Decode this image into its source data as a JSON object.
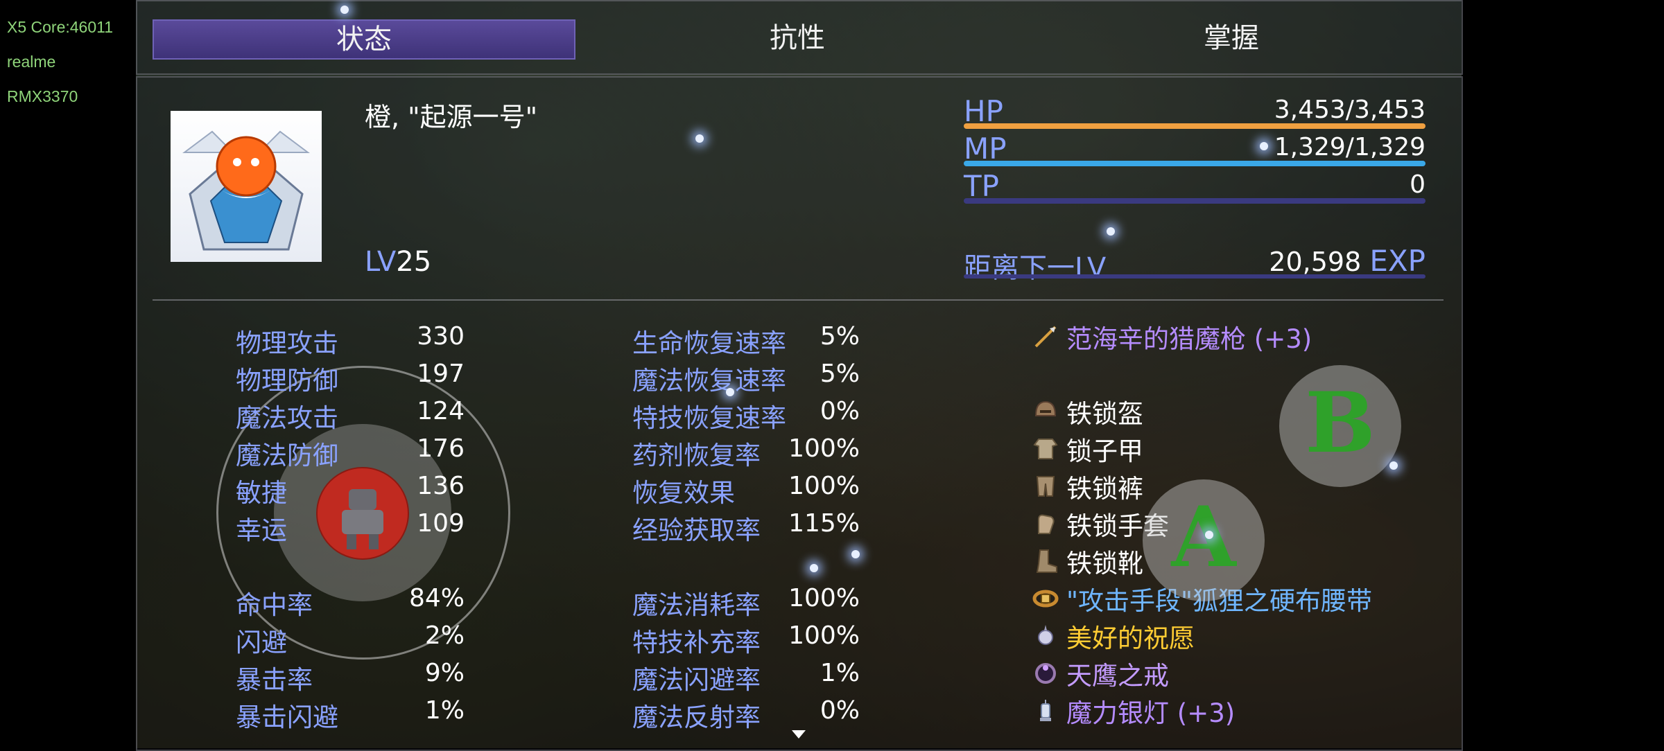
{
  "device": {
    "line1": "X5 Core:46011",
    "line2": "realme",
    "line3": "RMX3370"
  },
  "tabs": [
    {
      "label": "状态"
    },
    {
      "label": "抗性"
    },
    {
      "label": "掌握"
    }
  ],
  "character": {
    "name": "橙, \"起源一号\"",
    "level_label": "LV",
    "level": "25"
  },
  "resources": {
    "hp": {
      "label": "HP",
      "value": "3,453/3,453",
      "fill": 1.0,
      "color": "#f0a040"
    },
    "mp": {
      "label": "MP",
      "value": "1,329/1,329",
      "fill": 1.0,
      "color": "#3aa8e8"
    },
    "tp": {
      "label": "TP",
      "value": "0",
      "fill": 0.0,
      "color": "#4a4aa0"
    },
    "next": {
      "label": "距离下一LV",
      "value": "20,598",
      "unit": "EXP"
    }
  },
  "stats_basic": [
    {
      "label": "物理攻击",
      "value": "330"
    },
    {
      "label": "物理防御",
      "value": "197"
    },
    {
      "label": "魔法攻击",
      "value": "124"
    },
    {
      "label": "魔法防御",
      "value": "176"
    },
    {
      "label": "敏捷",
      "value": "136"
    },
    {
      "label": "幸运",
      "value": "109"
    }
  ],
  "stats_rates": [
    {
      "label": "命中率",
      "value": "84%"
    },
    {
      "label": "闪避",
      "value": "2%"
    },
    {
      "label": "暴击率",
      "value": "9%"
    },
    {
      "label": "暴击闪避",
      "value": "1%"
    }
  ],
  "stats_recovery": [
    {
      "label": "生命恢复速率",
      "value": "5%"
    },
    {
      "label": "魔法恢复速率",
      "value": "5%"
    },
    {
      "label": "特技恢复速率",
      "value": "0%"
    },
    {
      "label": "药剂恢复率",
      "value": "100%"
    },
    {
      "label": "恢复效果",
      "value": "100%"
    },
    {
      "label": "经验获取率",
      "value": "115%"
    }
  ],
  "stats_magic": [
    {
      "label": "魔法消耗率",
      "value": "100%"
    },
    {
      "label": "特技补充率",
      "value": "100%"
    },
    {
      "label": "魔法闪避率",
      "value": "1%"
    },
    {
      "label": "魔法反射率",
      "value": "0%"
    }
  ],
  "equipment": [
    {
      "name": "范海辛的猎魔枪 (+3)",
      "icon": "spear-icon",
      "color": "#b58cff"
    },
    {
      "name": "铁锁盔",
      "icon": "helmet-icon",
      "color": "#ffffff"
    },
    {
      "name": "锁子甲",
      "icon": "armor-icon",
      "color": "#ffffff"
    },
    {
      "name": "铁锁裤",
      "icon": "pants-icon",
      "color": "#ffffff"
    },
    {
      "name": "铁锁手套",
      "icon": "gloves-icon",
      "color": "#ffffff"
    },
    {
      "name": "铁锁靴",
      "icon": "boots-icon",
      "color": "#ffffff"
    },
    {
      "name": "\"攻击手段\"狐狸之硬布腰带",
      "icon": "belt-icon",
      "color": "#6fb6ff"
    },
    {
      "name": "美好的祝愿",
      "icon": "charm-icon",
      "color": "#ffcc33"
    },
    {
      "name": "天鹰之戒",
      "icon": "ring-icon",
      "color": "#c49cff"
    },
    {
      "name": "魔力银灯 (+3)",
      "icon": "lamp-icon",
      "color": "#b58cff"
    }
  ],
  "controls": {
    "button_a": "A",
    "button_b": "B"
  },
  "colors": {
    "accent_label": "#8aa2ff",
    "tab_active": "#4a3d8a"
  }
}
